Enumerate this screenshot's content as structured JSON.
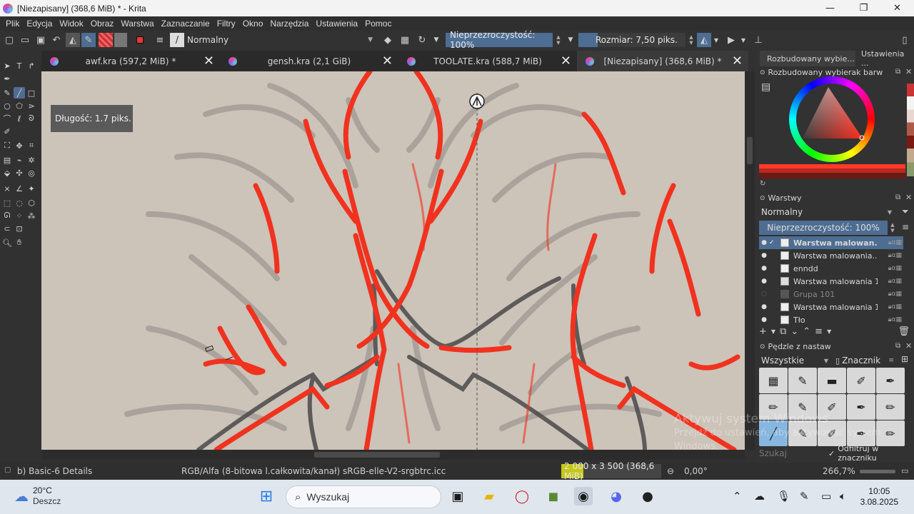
{
  "window": {
    "title": "[Niezapisany]  (368,6 MiB) * - Krita",
    "minimize": "—",
    "maximize": "❐",
    "close": "✕"
  },
  "menu": [
    "Plik",
    "Edycja",
    "Widok",
    "Obraz",
    "Warstwa",
    "Zaznaczanie",
    "Filtry",
    "Okno",
    "Narzędzia",
    "Ustawienia",
    "Pomoc"
  ],
  "toolbar": {
    "blend_mode": "Normalny",
    "opacity": "Nieprzezroczystość: 100%",
    "size": "Rozmiar: 7,50 piks."
  },
  "tabs": [
    {
      "label": "awf.kra (597,2 MiB) *"
    },
    {
      "label": "gensh.kra (2,1 GiB)"
    },
    {
      "label": "TOOLATE.kra (588,7 MiB)"
    },
    {
      "label": "[Niezapisany]  (368,6 MiB) *"
    }
  ],
  "canvas": {
    "length_tooltip": "Długość: 1.7 piks."
  },
  "status": {
    "brush_preset": "b) Basic-6 Details",
    "color_model": "RGB/Alfa (8-bitowa l.całkowita/kanał)  sRGB-elle-V2-srgbtrc.icc",
    "image_size": "2 000 x 3 500 (368,6 MiB)",
    "rotation": "0,00°",
    "zoom": "266,7%"
  },
  "dock": {
    "tabs": [
      "Rozbudowany wybie...",
      "Ustawienia ..."
    ],
    "color_panel_title": "Rozbudowany wybierak barw",
    "layers_panel_title": "Warstwy",
    "layers_blend": "Normalny",
    "layers_opacity": "Nieprzezroczystość:  100%",
    "layers": [
      {
        "name": "Warstwa malowan...",
        "selected": true
      },
      {
        "name": "Warstwa malowania...",
        "selected": false
      },
      {
        "name": "enndd",
        "selected": false
      },
      {
        "name": "Warstwa malowania 1",
        "selected": false
      },
      {
        "name": "Grupa 101",
        "selected": false
      },
      {
        "name": "Warstwa malowania 1",
        "selected": false
      },
      {
        "name": "Tło",
        "selected": false
      }
    ],
    "brushes_panel_title": "Pędzle z nastaw",
    "brush_filter": "Wszystkie",
    "brush_tag": "Znacznik",
    "brush_search_placeholder": "Szukaj",
    "filter_in_tag": "Odfiltruj w znaczniku"
  },
  "watermark": {
    "line1": "Aktywuj system Windows",
    "line2": "Przejdź do ustawień, aby aktywować system",
    "line3": "Windows."
  },
  "taskbar": {
    "weather_temp": "20°C",
    "weather_desc": "Deszcz",
    "search": "Wyszukaj",
    "time": "10:05",
    "date": "3.08.2025"
  },
  "colors": {
    "accent": "#4e6d92",
    "canvas_bg": "#ccc3b9",
    "sketch_red": "#f0321e",
    "sketch_dark": "#555555"
  }
}
